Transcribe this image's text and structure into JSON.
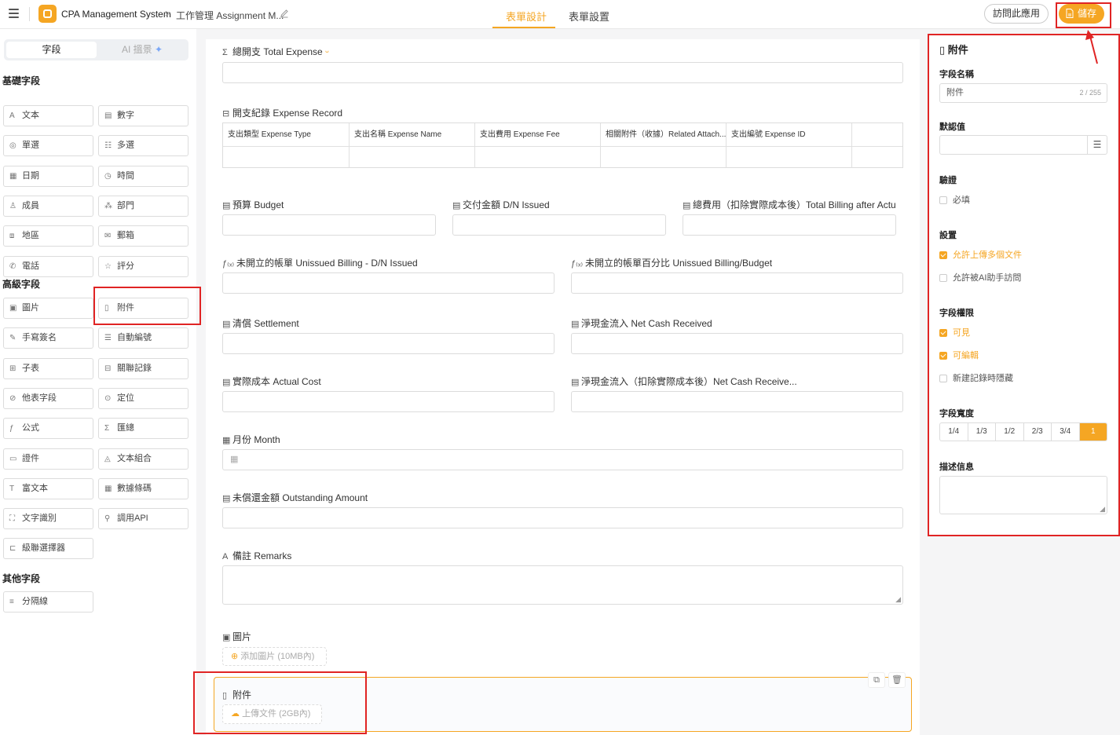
{
  "header": {
    "app_name": "CPA Management System",
    "breadcrumb_sep": ">",
    "form_name": "工作管理 Assignment M...",
    "tabs": [
      "表單設計",
      "表單設置"
    ],
    "visit_label": "訪問此應用",
    "save_label": "儲存"
  },
  "left": {
    "tab_fields": "字段",
    "tab_ai": "AI 搵景",
    "basic_title": "基礎字段",
    "basic": [
      {
        "label": "文本",
        "icon": "text-icon"
      },
      {
        "label": "數字",
        "icon": "number-icon"
      },
      {
        "label": "單選",
        "icon": "radio-icon"
      },
      {
        "label": "多選",
        "icon": "checklist-icon"
      },
      {
        "label": "日期",
        "icon": "calendar-icon"
      },
      {
        "label": "時間",
        "icon": "clock-icon"
      },
      {
        "label": "成員",
        "icon": "user-icon"
      },
      {
        "label": "部門",
        "icon": "org-icon"
      },
      {
        "label": "地區",
        "icon": "map-icon"
      },
      {
        "label": "郵箱",
        "icon": "mail-icon"
      },
      {
        "label": "電話",
        "icon": "phone-icon"
      },
      {
        "label": "評分",
        "icon": "star-icon"
      }
    ],
    "advanced_title": "高級字段",
    "advanced": [
      {
        "label": "圖片",
        "icon": "image-icon"
      },
      {
        "label": "附件",
        "icon": "file-icon"
      },
      {
        "label": "手寫簽名",
        "icon": "pen-icon"
      },
      {
        "label": "自動編號",
        "icon": "numbered-list-icon"
      },
      {
        "label": "子表",
        "icon": "table-icon"
      },
      {
        "label": "關聯記錄",
        "icon": "database-icon"
      },
      {
        "label": "他表字段",
        "icon": "link-icon"
      },
      {
        "label": "定位",
        "icon": "location-icon"
      },
      {
        "label": "公式",
        "icon": "formula-icon"
      },
      {
        "label": "匯總",
        "icon": "sigma-icon"
      },
      {
        "label": "證件",
        "icon": "id-card-icon"
      },
      {
        "label": "文本組合",
        "icon": "shapes-icon"
      },
      {
        "label": "富文本",
        "icon": "rich-text-icon"
      },
      {
        "label": "數據條碼",
        "icon": "qr-icon"
      },
      {
        "label": "文字識別",
        "icon": "scan-icon"
      },
      {
        "label": "調用API",
        "icon": "api-icon"
      },
      {
        "label": "級聯選擇器",
        "icon": "cascade-icon"
      }
    ],
    "other_title": "其他字段",
    "other": [
      {
        "label": "分隔線",
        "icon": "divider-icon"
      }
    ]
  },
  "form": {
    "total_expense": "總開支 Total Expense",
    "expense_record": "開支紀錄 Expense Record",
    "table_columns": [
      "支出類型 Expense Type",
      "支出名稱 Expense Name",
      "支出費用 Expense Fee",
      "相關附件（收據）Related Attach...",
      "支出編號 Expense ID"
    ],
    "budget": "預算 Budget",
    "dn_issued": "交付金額 D/N Issued",
    "total_billing": "總費用（扣除實際成本後）Total Billing after Actu...",
    "unissued_billing": "未開立的帳單 Unissued Billing - D/N Issued",
    "unissued_pct": "未開立的帳單百分比 Unissued Billing/Budget",
    "settlement": "清償 Settlement",
    "net_cash": "淨現金流入 Net Cash Received",
    "actual_cost": "實際成本 Actual Cost",
    "net_cash_after": "淨現金流入（扣除實際成本後）Net Cash Receive...",
    "month": "月份 Month",
    "outstanding": "未償還金額 Outstanding Amount",
    "remarks": "備註 Remarks",
    "image_label": "圖片",
    "image_add": "添加圖片 (10MB內)",
    "attach_label": "附件",
    "attach_upload": "上傳文件 (2GB內)"
  },
  "right": {
    "title": "附件",
    "field_name_label": "字段名稱",
    "field_name_value": "附件",
    "field_name_count": "2 / 255",
    "default_label": "默認值",
    "validation_label": "驗證",
    "required": "必填",
    "settings_label": "設置",
    "allow_multi": "允許上傳多個文件",
    "allow_ai": "允許被AI助手訪問",
    "perm_label": "字段權限",
    "visible": "可見",
    "editable": "可編輯",
    "hide_new": "新建記錄時隱藏",
    "width_label": "字段寬度",
    "widths": [
      "1/4",
      "1/3",
      "1/2",
      "2/3",
      "3/4",
      "1"
    ],
    "desc_label": "描述信息"
  },
  "colors": {
    "accent": "#f5a623",
    "highlight": "#e02424"
  }
}
